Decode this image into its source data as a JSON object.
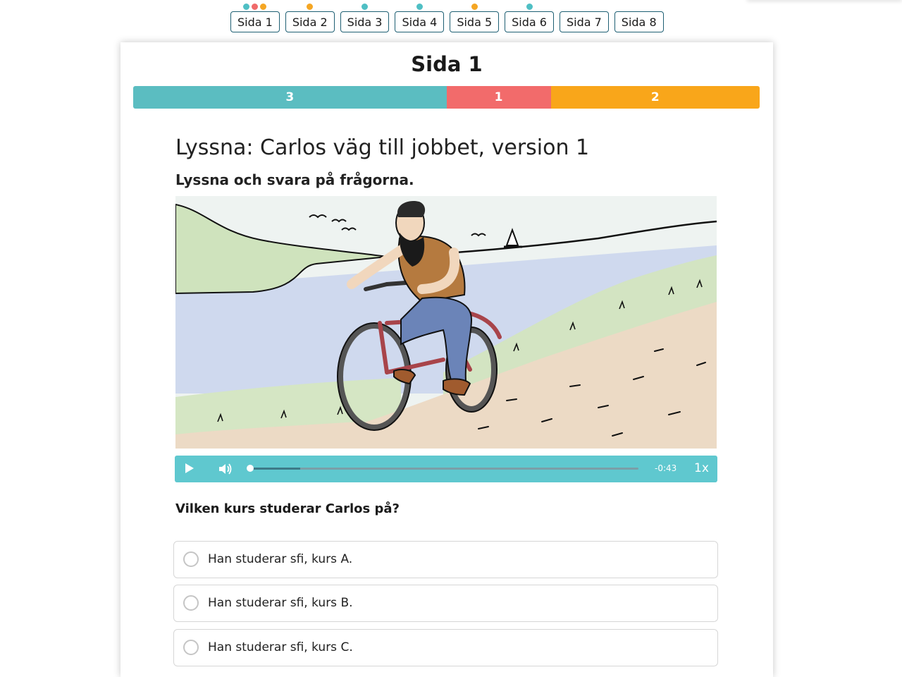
{
  "page_nav": [
    {
      "label": "Sida 1",
      "dots": [
        "#4fbfc4",
        "#f06a6a",
        "#f5a623"
      ]
    },
    {
      "label": "Sida 2",
      "dots": [
        "#f5a623"
      ]
    },
    {
      "label": "Sida 3",
      "dots": [
        "#4fbfc4"
      ]
    },
    {
      "label": "Sida 4",
      "dots": [
        "#4fbfc4"
      ]
    },
    {
      "label": "Sida 5",
      "dots": [
        "#f5a623"
      ]
    },
    {
      "label": "Sida 6",
      "dots": [
        "#4fbfc4"
      ]
    },
    {
      "label": "Sida 7",
      "dots": []
    },
    {
      "label": "Sida 8",
      "dots": []
    }
  ],
  "card": {
    "title": "Sida 1",
    "score_bar": [
      {
        "label": "3",
        "value": 3,
        "color": "#5bbdc1"
      },
      {
        "label": "1",
        "value": 1,
        "color": "#f26b6b"
      },
      {
        "label": "2",
        "value": 2,
        "color": "#f9a61a"
      }
    ]
  },
  "exercise": {
    "title": "Lyssna: Carlos väg till jobbet, version 1",
    "instruction": "Lyssna och svara på frågorna."
  },
  "audio": {
    "time_remaining": "-0:43",
    "speed": "1x",
    "progress": 0.0,
    "buffered": 0.13,
    "icons": [
      "play-icon",
      "volume-icon"
    ]
  },
  "question": {
    "text": "Vilken kurs studerar Carlos på?",
    "options": [
      "Han studerar sfi, kurs A.",
      "Han studerar sfi, kurs B.",
      "Han studerar sfi, kurs C."
    ]
  }
}
